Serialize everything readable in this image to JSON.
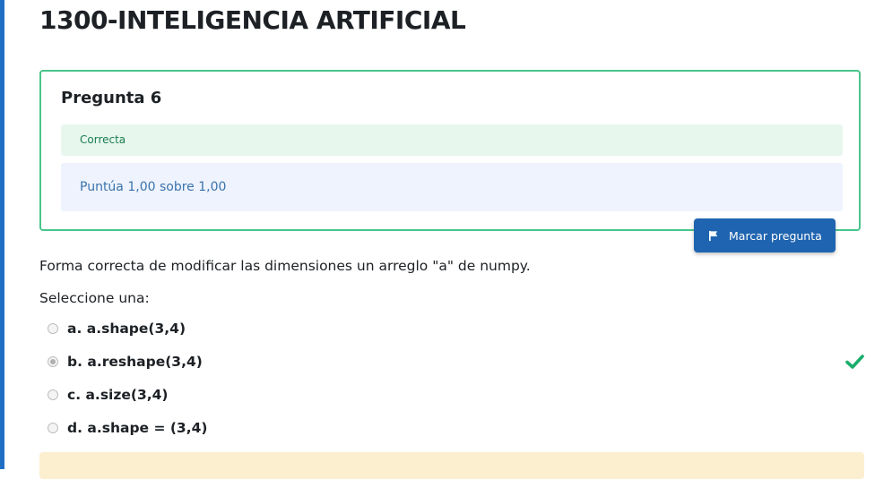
{
  "course": {
    "title": "1300-INTELIGENCIA ARTIFICIAL"
  },
  "question": {
    "number_label": "Pregunta 6",
    "state": "Correcta",
    "grade": "Puntúa 1,00 sobre 1,00",
    "flag_button": "Marcar pregunta",
    "text": "Forma correcta de modificar las dimensiones un arreglo \"a\" de numpy.",
    "prompt": "Seleccione una:",
    "options": [
      {
        "label": "a. a.shape(3,4)",
        "selected": false
      },
      {
        "label": "b. a.reshape(3,4)",
        "selected": true,
        "correct": true
      },
      {
        "label": "c. a.size(3,4)",
        "selected": false
      },
      {
        "label": "d. a.shape = (3,4)",
        "selected": false
      }
    ]
  },
  "colors": {
    "accent": "#1f64b0",
    "correct_border": "#48c58a",
    "correct_bg": "#e7f7ee",
    "grade_bg": "#eef3fd",
    "feedback_bg": "#fcefcf",
    "check": "#1aae6b"
  },
  "icons": {
    "flag": "flag-icon",
    "correct": "check-icon"
  }
}
